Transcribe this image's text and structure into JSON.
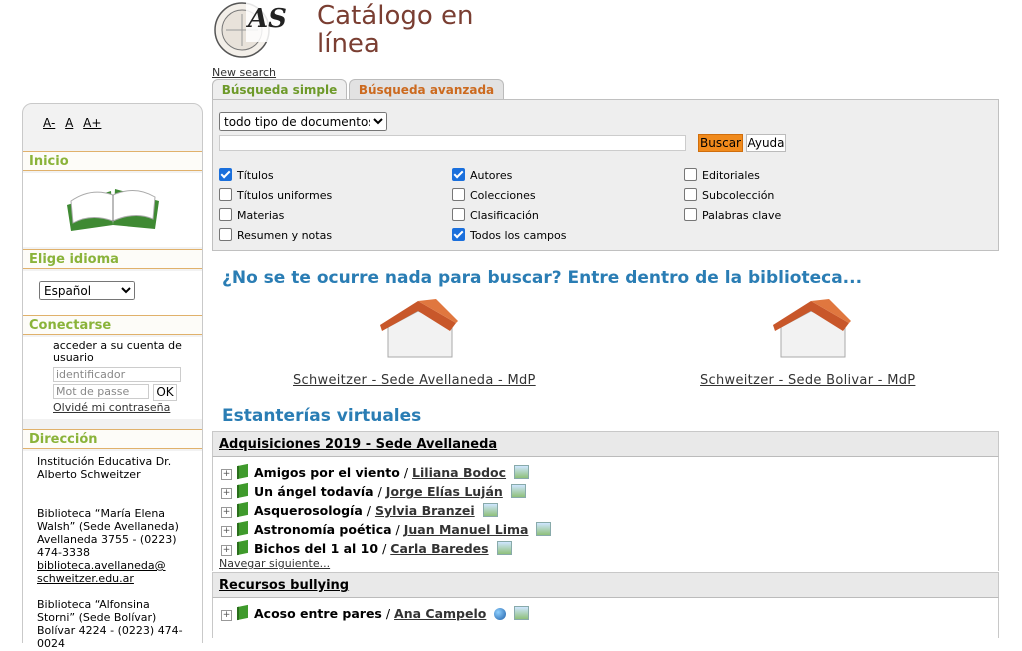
{
  "header": {
    "logo_alt": "Institución Educativa Dr. Alberto Schweitzer",
    "logo_initials": "AS",
    "title": "Catálogo en línea",
    "new_search": "New search"
  },
  "sidebar": {
    "font_sizes": [
      "A-",
      "A",
      "A+"
    ],
    "home_heading": "Inicio",
    "language_heading": "Elige idioma",
    "language_selected": "Español",
    "login_heading": "Conectarse",
    "login_text": "acceder a su cuenta de usuario",
    "login_id_placeholder": "identificador",
    "login_pass_placeholder": "Mot de passe",
    "login_ok": "OK",
    "forgot_password": "Olvidé mi contraseña",
    "address_heading": "Dirección",
    "address_institution": "Institución Educativa Dr. Alberto Schweitzer",
    "address_lib1": "Biblioteca “María Elena Walsh” (Sede Avellaneda) Avellaneda 3755 - (0223) 474-3338",
    "address_lib1_email": "biblioteca.avellaneda@ schweitzer.edu.ar",
    "address_lib2": "Biblioteca “Alfonsina Storni” (Sede Bolívar) Bolívar 4224 - (0223) 474-0024"
  },
  "tabs": {
    "simple": "Búsqueda simple",
    "advanced": "Búsqueda avanzada"
  },
  "search": {
    "doc_type": "todo tipo de documentos",
    "button": "Buscar",
    "help": "Ayuda",
    "fields": [
      {
        "label": "Títulos",
        "checked": true
      },
      {
        "label": "Títulos uniformes",
        "checked": false
      },
      {
        "label": "Materias",
        "checked": false
      },
      {
        "label": "Resumen y notas",
        "checked": false
      },
      {
        "label": "Autores",
        "checked": true
      },
      {
        "label": "Colecciones",
        "checked": false
      },
      {
        "label": "Clasificación",
        "checked": false
      },
      {
        "label": "Todos los campos",
        "checked": true
      },
      {
        "label": "Editoriales",
        "checked": false
      },
      {
        "label": "Subcolección",
        "checked": false
      },
      {
        "label": "Palabras clave",
        "checked": false
      }
    ]
  },
  "library": {
    "prompt": "¿No se te ocurre nada para buscar? Entre dentro de la biblioteca...",
    "branch1": "Schweitzer - Sede Avellaneda - MdP",
    "branch2": "Schweitzer - Sede Bolivar - MdP"
  },
  "shelves": {
    "title": "Estanterías virtuales",
    "shelf1_title": "Adquisiciones 2019 - Sede Avellaneda",
    "shelf1_items": [
      {
        "title": "Amigos por el viento",
        "author": "Liliana Bodoc"
      },
      {
        "title": "Un ángel todavía",
        "author": "Jorge Elías Luján"
      },
      {
        "title": "Asquerosología",
        "author": "Sylvia Branzei"
      },
      {
        "title": "Astronomía poética",
        "author": "Juan Manuel Lima"
      },
      {
        "title": "Bichos del 1 al 10",
        "author": "Carla Baredes"
      }
    ],
    "next": "Navegar siguiente...",
    "shelf2_title": "Recursos bullying",
    "shelf2_items": [
      {
        "title": "Acoso entre pares",
        "author": "Ana Campelo"
      }
    ]
  },
  "colors": {
    "accent_green": "#8ab33a",
    "accent_orange": "#f08a1c",
    "link_blue": "#2a7db4",
    "title_brown": "#7a3e32"
  }
}
